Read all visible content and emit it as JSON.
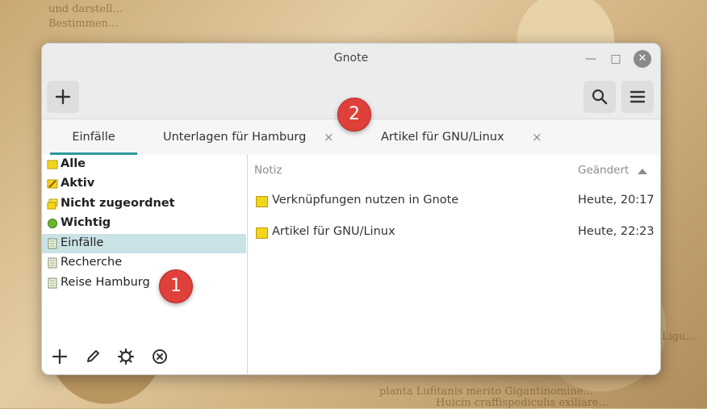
{
  "window": {
    "title": "Gnote"
  },
  "toolbar": {
    "new_note": "+",
    "search": "search-icon",
    "menu": "hamburger-menu-icon"
  },
  "tabs": [
    {
      "label": "Einfälle",
      "active": true,
      "closable": false
    },
    {
      "label": "Unterlagen für Hamburg",
      "active": false,
      "closable": true
    },
    {
      "label": "Artikel für GNU/Linux",
      "active": false,
      "closable": true
    }
  ],
  "tab_close_glyph": "×",
  "sidebar": {
    "items": [
      {
        "label": "Alle",
        "bold": true,
        "icon": "all-notes-icon"
      },
      {
        "label": "Aktiv",
        "bold": true,
        "icon": "active-notes-icon"
      },
      {
        "label": "Nicht zugeordnet",
        "bold": true,
        "icon": "unfiled-notes-icon"
      },
      {
        "label": "Wichtig",
        "bold": true,
        "icon": "important-notes-icon"
      },
      {
        "label": "Einfälle",
        "bold": false,
        "icon": "notebook-icon",
        "selected": true
      },
      {
        "label": "Recherche",
        "bold": false,
        "icon": "notebook-icon"
      },
      {
        "label": "Reise Hamburg",
        "bold": false,
        "icon": "notebook-icon"
      }
    ],
    "actions": [
      "add-icon",
      "edit-icon",
      "settings-icon",
      "delete-icon"
    ]
  },
  "list": {
    "columns": {
      "title": "Notiz",
      "date": "Geändert"
    },
    "sort": "ascending",
    "rows": [
      {
        "title": "Verknüpfungen nutzen in Gnote",
        "date": "Heute, 20:17"
      },
      {
        "title": "Artikel für GNU/Linux",
        "date": "Heute, 22:23"
      }
    ]
  },
  "annotations": [
    "1",
    "2"
  ],
  "colors": {
    "accent": "#2a9aa0",
    "selection": "#c9e2e6",
    "badge": "#e0403a",
    "note_icon": "#f2d51a"
  }
}
